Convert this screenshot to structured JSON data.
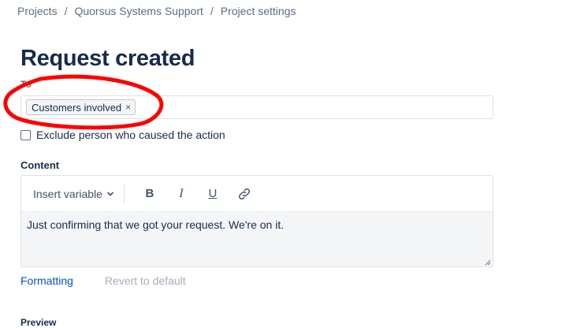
{
  "breadcrumb": {
    "items": [
      "Projects",
      "Quorsus Systems Support",
      "Project settings"
    ],
    "separator": "/"
  },
  "page": {
    "title": "Request created"
  },
  "recipients": {
    "label": "To",
    "tags": [
      {
        "label": "Customers involved",
        "remove_glyph": "×"
      }
    ]
  },
  "exclude": {
    "label": "Exclude person who caused the action",
    "checked": false
  },
  "content": {
    "label": "Content",
    "toolbar": {
      "insert_variable_label": "Insert variable",
      "bold_label": "B",
      "italic_label": "I",
      "underline_label": "U"
    },
    "body_text": "Just confirming that we got your request. We're on it."
  },
  "links": {
    "formatting_label": "Formatting",
    "revert_label": "Revert to default"
  },
  "preview": {
    "label": "Preview"
  },
  "colors": {
    "title": "#172b4d",
    "link": "#0052cc",
    "muted": "#5e6c84",
    "disabled": "#a5adba",
    "annotation": "#ff0000"
  },
  "icons": [
    "chevron-down-icon",
    "link-icon",
    "close-icon",
    "resize-handle-icon"
  ]
}
